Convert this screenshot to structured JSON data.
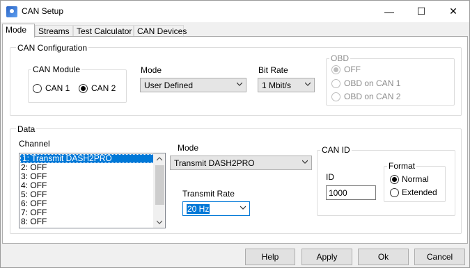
{
  "window": {
    "title": "CAN Setup",
    "minimize_glyph": "—",
    "maximize_glyph": "☐",
    "close_glyph": "✕"
  },
  "tabs": [
    "Mode",
    "Streams",
    "Test Calculator",
    "CAN Devices"
  ],
  "can_config": {
    "group_label": "CAN Configuration",
    "module": {
      "label": "CAN Module",
      "options": [
        "CAN 1",
        "CAN 2"
      ],
      "selected": "CAN 2"
    },
    "mode": {
      "label": "Mode",
      "value": "User Defined"
    },
    "bitrate": {
      "label": "Bit Rate",
      "value": "1 Mbit/s"
    },
    "obd": {
      "label": "OBD",
      "options": [
        "OFF",
        "OBD on CAN 1",
        "OBD on CAN 2"
      ],
      "selected": "OFF"
    }
  },
  "data": {
    "group_label": "Data",
    "channel": {
      "label": "Channel",
      "items": [
        "1: Transmit DASH2PRO",
        "2: OFF",
        "3: OFF",
        "4: OFF",
        "5: OFF",
        "6: OFF",
        "7: OFF",
        "8: OFF"
      ],
      "selected_index": 0
    },
    "mode": {
      "label": "Mode",
      "value": "Transmit DASH2PRO"
    },
    "transmit_rate": {
      "label": "Transmit Rate",
      "value": "20 Hz"
    },
    "can_id": {
      "label": "CAN ID",
      "id_label": "ID",
      "id_value": "1000",
      "format": {
        "label": "Format",
        "options": [
          "Normal",
          "Extended"
        ],
        "selected": "Normal"
      }
    }
  },
  "buttons": {
    "help": "Help",
    "apply": "Apply",
    "ok": "Ok",
    "cancel": "Cancel"
  },
  "icons": {
    "app": "can-setup-app-icon",
    "dropdown": "chevron-down-icon",
    "scroll_up": "chevron-up-icon",
    "scroll_down": "chevron-down-icon"
  },
  "colors": {
    "selection": "#0078d7",
    "disabled_text": "#8d8d8d"
  }
}
